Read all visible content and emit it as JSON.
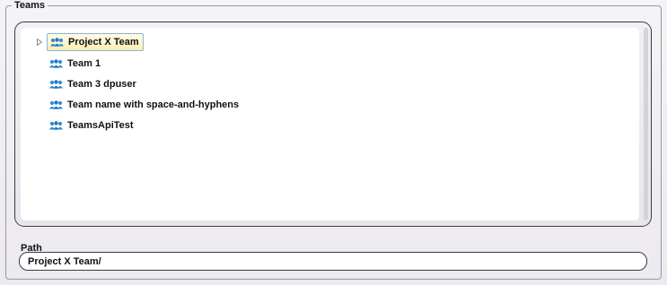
{
  "teams_group": {
    "title": "Teams",
    "items": [
      {
        "label": "Project X Team",
        "selected": true,
        "expandable": true,
        "icon": "team-icon"
      },
      {
        "label": "Team 1",
        "selected": false,
        "expandable": false,
        "icon": "team-icon"
      },
      {
        "label": "Team 3 dpuser",
        "selected": false,
        "expandable": false,
        "icon": "team-icon"
      },
      {
        "label": "Team name with space-and-hyphens",
        "selected": false,
        "expandable": false,
        "icon": "team-icon"
      },
      {
        "label": "TeamsApiTest",
        "selected": false,
        "expandable": false,
        "icon": "team-icon"
      }
    ]
  },
  "path": {
    "label": "Path",
    "value": "Project X Team/"
  },
  "colors": {
    "icon_blue": "#2a8ad4",
    "selection_fill": "#fdeeb5",
    "selection_border": "#8fb3d9"
  }
}
